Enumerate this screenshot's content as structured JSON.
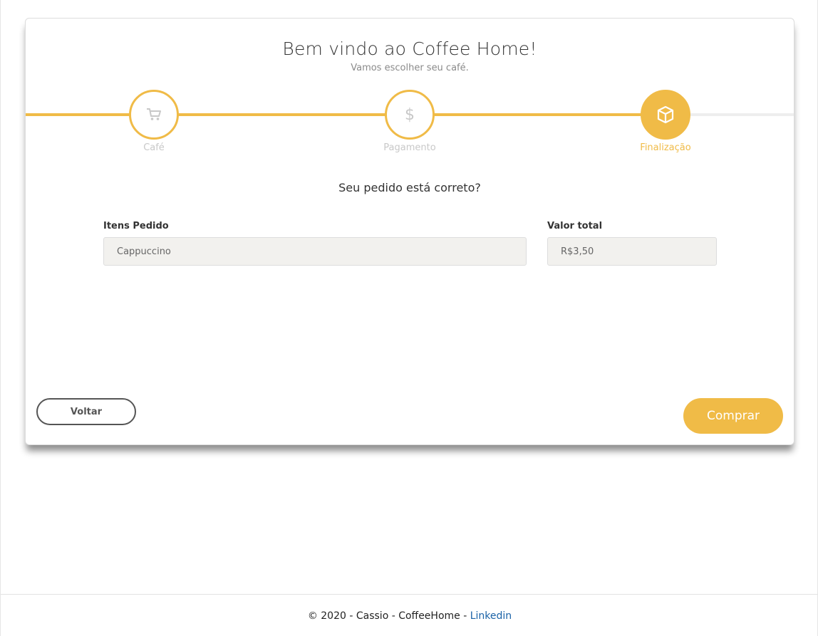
{
  "header": {
    "title": "Bem vindo ao Coffee Home!",
    "subtitle": "Vamos escolher seu café."
  },
  "steps": [
    {
      "label": "Café",
      "icon": "cart-icon",
      "state": "done"
    },
    {
      "label": "Pagamento",
      "icon": "dollar-icon",
      "icon_glyph": "$",
      "state": "done"
    },
    {
      "label": "Finalização",
      "icon": "box-icon",
      "state": "active"
    }
  ],
  "question": "Seu pedido está correto?",
  "order": {
    "items_label": "Itens Pedido",
    "items_value": "Cappuccino",
    "total_label": "Valor total",
    "total_value": "R$3,50"
  },
  "buttons": {
    "back_label": "Voltar",
    "buy_label": "Comprar"
  },
  "footer": {
    "text": "© 2020 - Cassio - CoffeeHome - ",
    "link_label": "Linkedin"
  },
  "colors": {
    "accent": "#f0bb47",
    "inactive": "#c8c8c8",
    "link": "#1a62a7"
  }
}
